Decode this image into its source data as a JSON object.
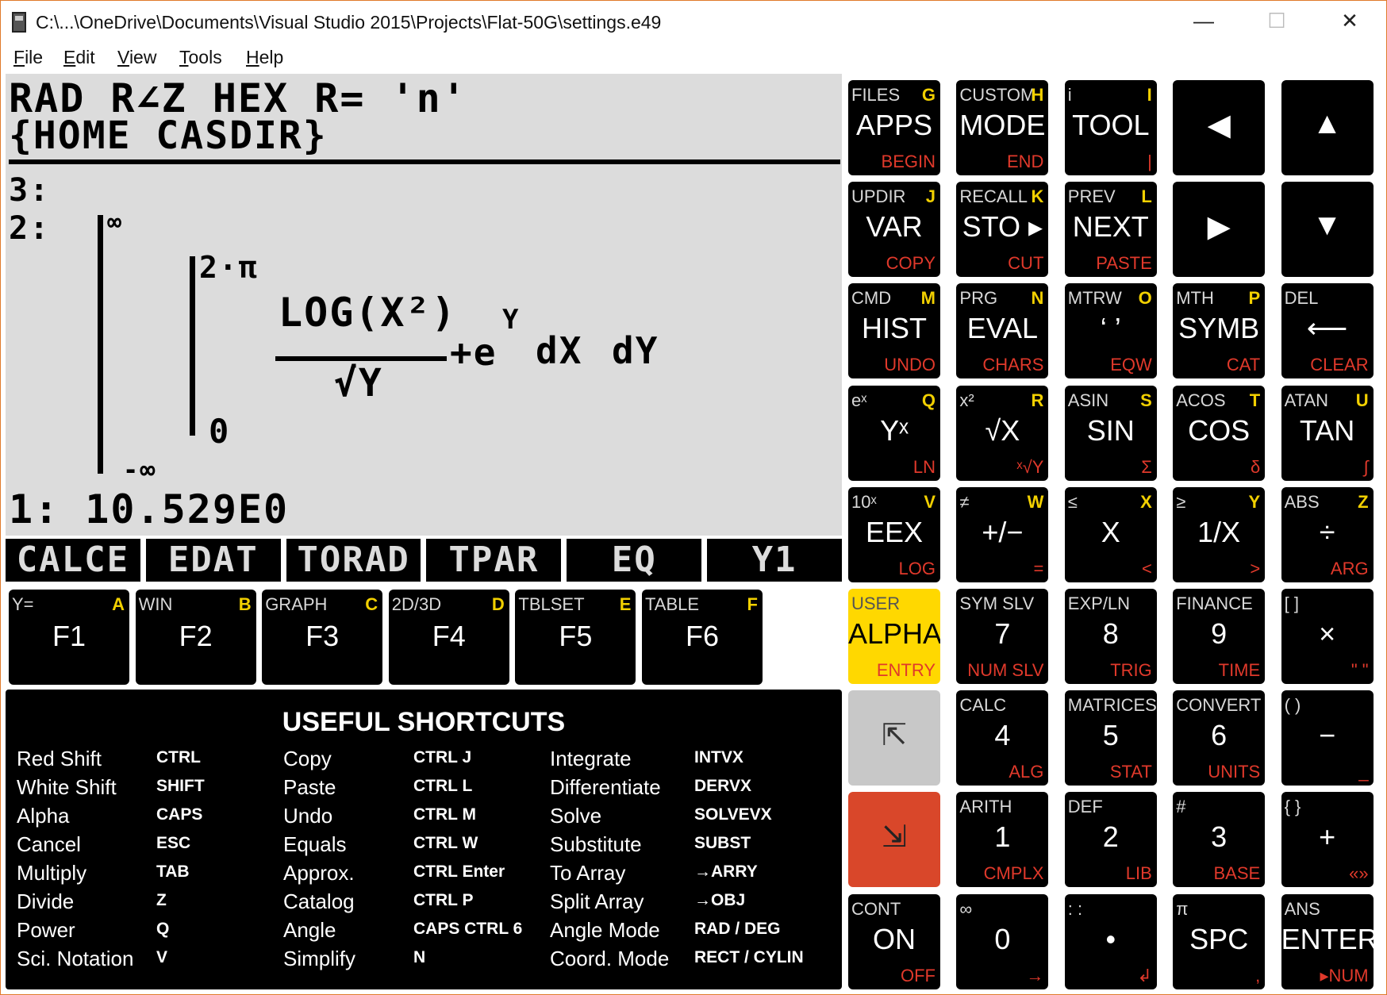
{
  "window": {
    "title": "C:\\...\\OneDrive\\Documents\\Visual Studio 2015\\Projects\\Flat-50G\\settings.e49",
    "minimize": "—",
    "maximize": "☐",
    "close": "✕"
  },
  "menu": [
    "File",
    "Edit",
    "View",
    "Tools",
    "Help"
  ],
  "lcd": {
    "status1": "RAD R∠Z HEX R= 'n'",
    "status2": "{HOME CASDIR}",
    "level3": "3:",
    "level2": "2:",
    "level1": "1: 10.529E0",
    "expr": {
      "outer_upper": "∞",
      "inner_upper": "2·π",
      "numerator": "LOG(X²)",
      "denominator": "√Y",
      "plus_e": "+e",
      "e_exp": "Y",
      "dx": "dX",
      "dy": "dY",
      "inner_lower": "0",
      "outer_lower": "-∞"
    },
    "softkeys": [
      "CALCE",
      "EDAT",
      "TORAD",
      "TPAR",
      "EQ",
      "Y1"
    ]
  },
  "fkeys": [
    {
      "tl": "Y=",
      "tr": "A",
      "main": "F1"
    },
    {
      "tl": "WIN",
      "tr": "B",
      "main": "F2"
    },
    {
      "tl": "GRAPH",
      "tr": "C",
      "main": "F3"
    },
    {
      "tl": "2D/3D",
      "tr": "D",
      "main": "F4"
    },
    {
      "tl": "TBLSET",
      "tr": "E",
      "main": "F5"
    },
    {
      "tl": "TABLE",
      "tr": "F",
      "main": "F6"
    }
  ],
  "keys": [
    [
      {
        "tl": "FILES",
        "tr": "G",
        "main": "APPS",
        "br": "BEGIN"
      },
      {
        "tl": "CUSTOM",
        "tr": "H",
        "main": "MODE",
        "br": "END"
      },
      {
        "tl": "i",
        "tr": "I",
        "main": "TOOL",
        "br": "|"
      },
      {
        "tl": "",
        "tr": "",
        "main": "◀",
        "br": ""
      },
      {
        "tl": "",
        "tr": "",
        "main": "▲",
        "br": ""
      }
    ],
    [
      {
        "tl": "UPDIR",
        "tr": "J",
        "main": "VAR",
        "br": "COPY"
      },
      {
        "tl": "RECALL",
        "tr": "K",
        "main": "STO ▸",
        "br": "CUT"
      },
      {
        "tl": "PREV",
        "tr": "L",
        "main": "NEXT",
        "br": "PASTE"
      },
      {
        "tl": "",
        "tr": "",
        "main": "▶",
        "br": ""
      },
      {
        "tl": "",
        "tr": "",
        "main": "▼",
        "br": ""
      }
    ],
    [
      {
        "tl": "CMD",
        "tr": "M",
        "main": "HIST",
        "br": "UNDO"
      },
      {
        "tl": "PRG",
        "tr": "N",
        "main": "EVAL",
        "br": "CHARS"
      },
      {
        "tl": "MTRW",
        "tr": "O",
        "main": "‘ ’",
        "br": "EQW"
      },
      {
        "tl": "MTH",
        "tr": "P",
        "main": "SYMB",
        "br": "CAT"
      },
      {
        "tl": "DEL",
        "tr": "",
        "main": "⟵",
        "br": "CLEAR"
      }
    ],
    [
      {
        "tl": "eˣ",
        "tr": "Q",
        "main": "Yˣ",
        "br": "LN"
      },
      {
        "tl": "x²",
        "tr": "R",
        "main": "√X",
        "br": "ˣ√Y"
      },
      {
        "tl": "ASIN",
        "tr": "S",
        "main": "SIN",
        "br": "Σ"
      },
      {
        "tl": "ACOS",
        "tr": "T",
        "main": "COS",
        "br": "δ"
      },
      {
        "tl": "ATAN",
        "tr": "U",
        "main": "TAN",
        "br": "∫"
      }
    ],
    [
      {
        "tl": "10ˣ",
        "tr": "V",
        "main": "EEX",
        "br": "LOG"
      },
      {
        "tl": "≠",
        "tr": "W",
        "main": "+/−",
        "br": "="
      },
      {
        "tl": "≤",
        "tr": "X",
        "main": "X",
        "br": "<"
      },
      {
        "tl": "≥",
        "tr": "Y",
        "main": "1/X",
        "br": ">"
      },
      {
        "tl": "ABS",
        "tr": "Z",
        "main": "÷",
        "br": "ARG"
      }
    ],
    [
      {
        "tl": "USER",
        "tr": "",
        "main": "ALPHA",
        "br": "ENTRY"
      },
      {
        "tl": "SYM SLV",
        "tr": "",
        "main": "7",
        "br": "NUM SLV"
      },
      {
        "tl": "EXP/LN",
        "tr": "",
        "main": "8",
        "br": "TRIG"
      },
      {
        "tl": "FINANCE",
        "tr": "",
        "main": "9",
        "br": "TIME"
      },
      {
        "tl": "[ ]",
        "tr": "",
        "main": "×",
        "br": "\" \""
      }
    ],
    [
      {
        "tl": "",
        "tr": "",
        "main": "⇱",
        "br": ""
      },
      {
        "tl": "CALC",
        "tr": "",
        "main": "4",
        "br": "ALG"
      },
      {
        "tl": "MATRICES",
        "tr": "",
        "main": "5",
        "br": "STAT"
      },
      {
        "tl": "CONVERT",
        "tr": "",
        "main": "6",
        "br": "UNITS"
      },
      {
        "tl": "( )",
        "tr": "",
        "main": "−",
        "br": "_"
      }
    ],
    [
      {
        "tl": "",
        "tr": "",
        "main": "⇲",
        "br": ""
      },
      {
        "tl": "ARITH",
        "tr": "",
        "main": "1",
        "br": "CMPLX"
      },
      {
        "tl": "DEF",
        "tr": "",
        "main": "2",
        "br": "LIB"
      },
      {
        "tl": "#",
        "tr": "",
        "main": "3",
        "br": "BASE"
      },
      {
        "tl": "{ }",
        "tr": "",
        "main": "+",
        "br": "«»"
      }
    ],
    [
      {
        "tl": "CONT",
        "tr": "",
        "main": "ON",
        "br": "OFF"
      },
      {
        "tl": "∞",
        "tr": "",
        "main": "0",
        "br": "→"
      },
      {
        "tl": ": :",
        "tr": "",
        "main": "•",
        "br": "↲"
      },
      {
        "tl": "π",
        "tr": "",
        "main": "SPC",
        "br": ","
      },
      {
        "tl": "ANS",
        "tr": "",
        "main": "ENTER",
        "br": "▸NUM"
      }
    ]
  ],
  "shortcuts": {
    "title": "USEFUL SHORTCUTS",
    "columns": [
      [
        [
          "Red Shift",
          "CTRL"
        ],
        [
          "White Shift",
          "SHIFT"
        ],
        [
          "Alpha",
          "CAPS"
        ],
        [
          "Cancel",
          "ESC"
        ],
        [
          "Multiply",
          "TAB"
        ],
        [
          "Divide",
          "Z"
        ],
        [
          "Power",
          "Q"
        ],
        [
          "Sci. Notation",
          "V"
        ]
      ],
      [
        [
          "Copy",
          "CTRL J"
        ],
        [
          "Paste",
          "CTRL L"
        ],
        [
          "Undo",
          "CTRL M"
        ],
        [
          "Equals",
          "CTRL W"
        ],
        [
          "Approx.",
          "CTRL Enter"
        ],
        [
          "Catalog",
          "CTRL P"
        ],
        [
          "Angle",
          "CAPS CTRL 6"
        ],
        [
          "Simplify",
          "N"
        ]
      ],
      [
        [
          "Integrate",
          "INTVX"
        ],
        [
          "Differentiate",
          "DERVX"
        ],
        [
          "Solve",
          "SOLVEVX"
        ],
        [
          "Substitute",
          "SUBST"
        ],
        [
          "To Array",
          "→ARRY"
        ],
        [
          "Split Array",
          "→OBJ"
        ],
        [
          "Angle Mode",
          "RAD / DEG"
        ],
        [
          "Coord. Mode",
          "RECT / CYLIN"
        ]
      ]
    ]
  }
}
